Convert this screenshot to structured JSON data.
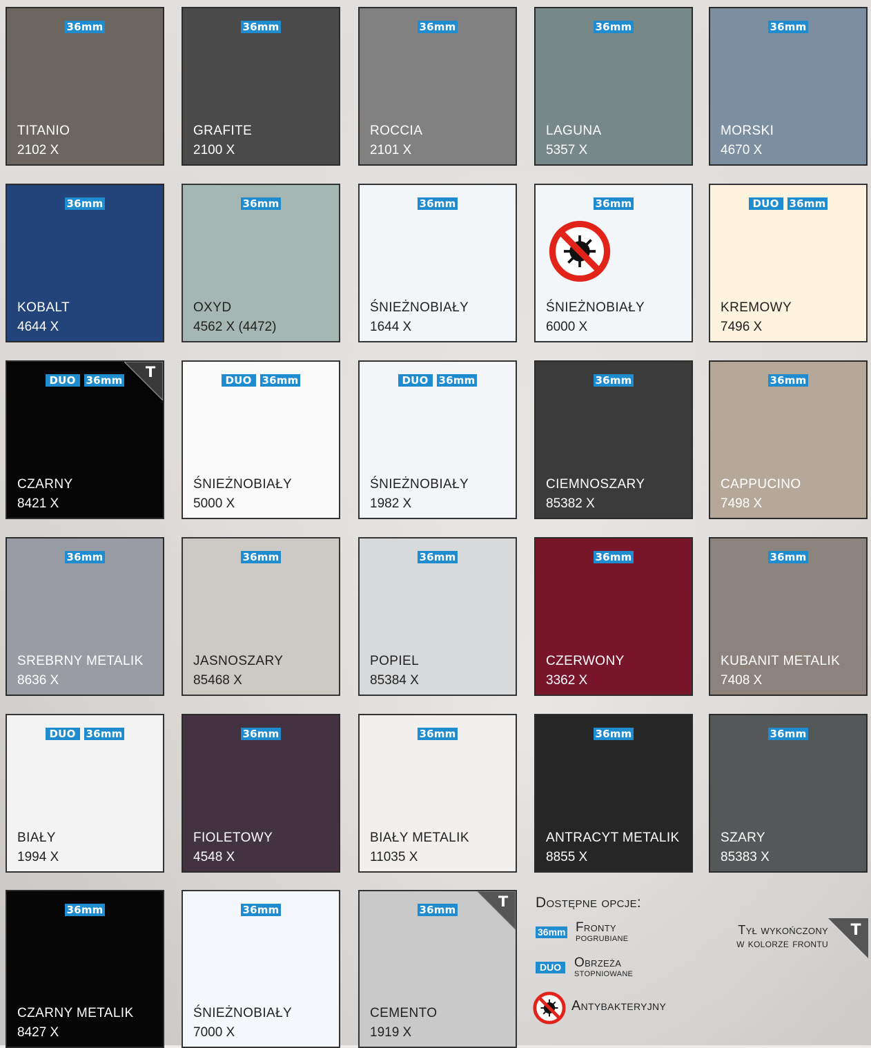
{
  "swatches": [
    {
      "name": "TITANIO",
      "code": "2102 X",
      "color": "#6b6760",
      "text": "light",
      "badges": [
        "36mm"
      ],
      "t": false,
      "anti": false
    },
    {
      "name": "GRAFITE",
      "code": "2100 X",
      "color": "#4a4a4b",
      "text": "light",
      "badges": [
        "36mm"
      ],
      "t": false,
      "anti": false
    },
    {
      "name": "ROCCIA",
      "code": "2101 X",
      "color": "#818181",
      "text": "light",
      "badges": [
        "36mm"
      ],
      "t": false,
      "anti": false
    },
    {
      "name": "LAGUNA",
      "code": "5357 X",
      "color": "#768887",
      "text": "light",
      "badges": [
        "36mm"
      ],
      "t": false,
      "anti": false
    },
    {
      "name": "MORSKI",
      "code": "4670 X",
      "color": "#7b8fa0",
      "text": "light",
      "badges": [
        "36mm"
      ],
      "t": false,
      "anti": false
    },
    {
      "name": "KOBALT",
      "code": "4644 X",
      "color": "#23447b",
      "text": "light",
      "badges": [
        "36mm"
      ],
      "t": false,
      "anti": false
    },
    {
      "name": "OXYD",
      "code": "4562 X (4472)",
      "color": "#a5b7b2",
      "text": "dark",
      "badges": [
        "36mm"
      ],
      "t": false,
      "anti": false
    },
    {
      "name": "ŚNIEŻNOBIAŁY",
      "code": "1644 X",
      "color": "#f3f6f9",
      "text": "dark",
      "badges": [
        "36mm"
      ],
      "t": false,
      "anti": false
    },
    {
      "name": "ŚNIEŻNOBIAŁY",
      "code": "6000 X",
      "color": "#f3f6f9",
      "text": "dark",
      "badges": [
        "36mm"
      ],
      "t": false,
      "anti": true
    },
    {
      "name": "KREMOWY",
      "code": "7496 X",
      "color": "#fdf3df",
      "text": "dark",
      "badges": [
        "DUO",
        "36mm"
      ],
      "t": false,
      "anti": false
    },
    {
      "name": "CZARNY",
      "code": "8421 X",
      "color": "#050505",
      "text": "light",
      "badges": [
        "DUO",
        "36mm"
      ],
      "t": true,
      "anti": false
    },
    {
      "name": "ŚNIEŻNOBIAŁY",
      "code": "5000 X",
      "color": "#fafafa",
      "text": "dark",
      "badges": [
        "DUO",
        "36mm"
      ],
      "t": false,
      "anti": false
    },
    {
      "name": "ŚNIEŻNOBIAŁY",
      "code": "1982 X",
      "color": "#f3f5f8",
      "text": "dark",
      "badges": [
        "DUO",
        "36mm"
      ],
      "t": false,
      "anti": false
    },
    {
      "name": "CIEMNOSZARY",
      "code": "85382 X",
      "color": "#3b3b3c",
      "text": "light",
      "badges": [
        "36mm"
      ],
      "t": false,
      "anti": false
    },
    {
      "name": "CAPPUCINO",
      "code": "7498 X",
      "color": "#b6a898",
      "text": "light",
      "badges": [
        "36mm"
      ],
      "t": false,
      "anti": false
    },
    {
      "name": "SREBRNY METALIK",
      "code": "8636 X",
      "color": "#999da3",
      "text": "light",
      "badges": [
        "36mm"
      ],
      "t": false,
      "anti": false
    },
    {
      "name": "JASNOSZARY",
      "code": "85468 X",
      "color": "#cdcac5",
      "text": "dark",
      "badges": [
        "36mm"
      ],
      "t": false,
      "anti": false
    },
    {
      "name": "POPIEL",
      "code": "85384 X",
      "color": "#d8d9db",
      "text": "dark",
      "badges": [
        "36mm"
      ],
      "t": false,
      "anti": false
    },
    {
      "name": "CZERWONY",
      "code": "3362 X",
      "color": "#781528",
      "text": "light",
      "badges": [
        "36mm"
      ],
      "t": false,
      "anti": false
    },
    {
      "name": "KUBANIT METALIK",
      "code": "7408 X",
      "color": "#8c847c",
      "text": "light",
      "badges": [
        "36mm"
      ],
      "t": false,
      "anti": false
    },
    {
      "name": "BIAŁY",
      "code": "1994 X",
      "color": "#f3f3f3",
      "text": "dark",
      "badges": [
        "DUO",
        "36mm"
      ],
      "t": false,
      "anti": false
    },
    {
      "name": "FIOLETOWY",
      "code": "4548 X",
      "color": "#433240",
      "text": "light",
      "badges": [
        "36mm"
      ],
      "t": false,
      "anti": false
    },
    {
      "name": "BIAŁY METALIK",
      "code": "11035 X",
      "color": "#f1f0ee",
      "text": "dark",
      "badges": [
        "36mm"
      ],
      "t": false,
      "anti": false
    },
    {
      "name": "ANTRACYT METALIK",
      "code": "8855 X",
      "color": "#262627",
      "text": "light",
      "badges": [
        "36mm"
      ],
      "t": false,
      "anti": false
    },
    {
      "name": "SZARY",
      "code": "85383 X",
      "color": "#555859",
      "text": "light",
      "badges": [
        "36mm"
      ],
      "t": false,
      "anti": false
    },
    {
      "name": "CZARNY METALIK",
      "code": "8427 X",
      "color": "#060606",
      "text": "light",
      "badges": [
        "36mm"
      ],
      "t": false,
      "anti": false
    },
    {
      "name": "ŚNIEŻNOBIAŁY",
      "code": "7000 X",
      "color": "#f4f7fb",
      "text": "dark",
      "badges": [
        "36mm"
      ],
      "t": false,
      "anti": false
    },
    {
      "name": "CEMENTO",
      "code": "1919 X",
      "color": "#c9c9c9",
      "text": "dark",
      "badges": [
        "36mm"
      ],
      "t": true,
      "anti": false
    }
  ],
  "legend": {
    "title": "Dostępne opcje:",
    "badge_36": "36mm",
    "badge_duo": "DUO",
    "fronty_1": "Fronty",
    "fronty_2": "pogrubiane",
    "obrzeza_1": "Obrzeża",
    "obrzeza_2": "stopniowane",
    "anti": "Antybakteryjny",
    "tyl_1": "Tył wykończony",
    "tyl_2": "w kolorze frontu",
    "t_letter": "T"
  },
  "badge_color": "#1e8ccf"
}
